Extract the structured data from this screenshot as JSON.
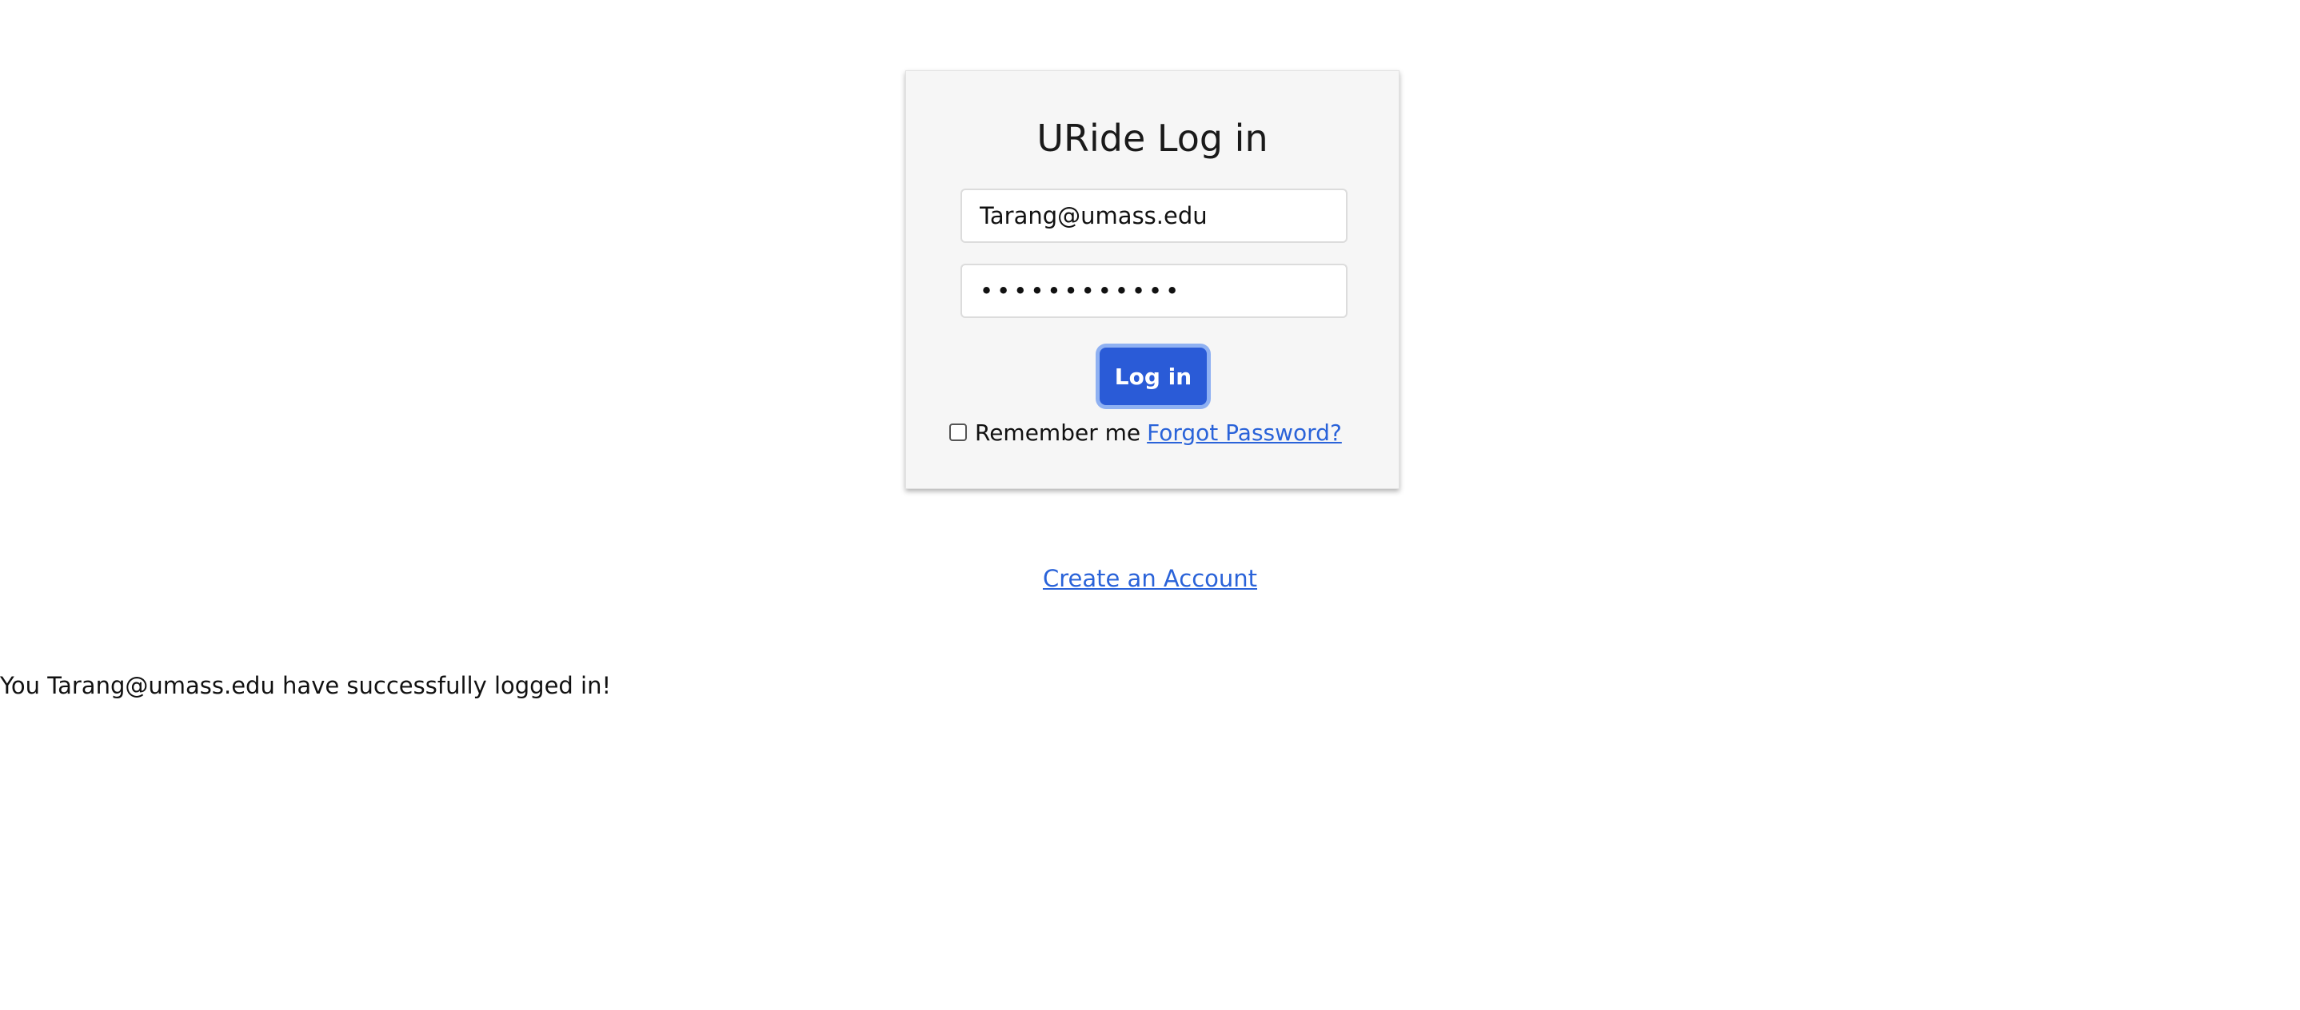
{
  "login_form": {
    "title": "URide Log in",
    "email_value": "Tarang@umass.edu",
    "password_value": "••••••••••••",
    "login_button_label": "Log in",
    "remember_me_label": "Remember me",
    "remember_me_checked": false,
    "forgot_password_link": "Forgot Password?"
  },
  "create_account_link": "Create an Account",
  "status_message": "You Tarang@umass.edu have successfully logged in!",
  "colors": {
    "page_background": "#ffffff",
    "card_background": "#f6f6f6",
    "button_background": "#2a5bd7",
    "button_focus_ring": "#8fb1f2",
    "link": "#2a63d9",
    "text": "#1a1a1a"
  }
}
